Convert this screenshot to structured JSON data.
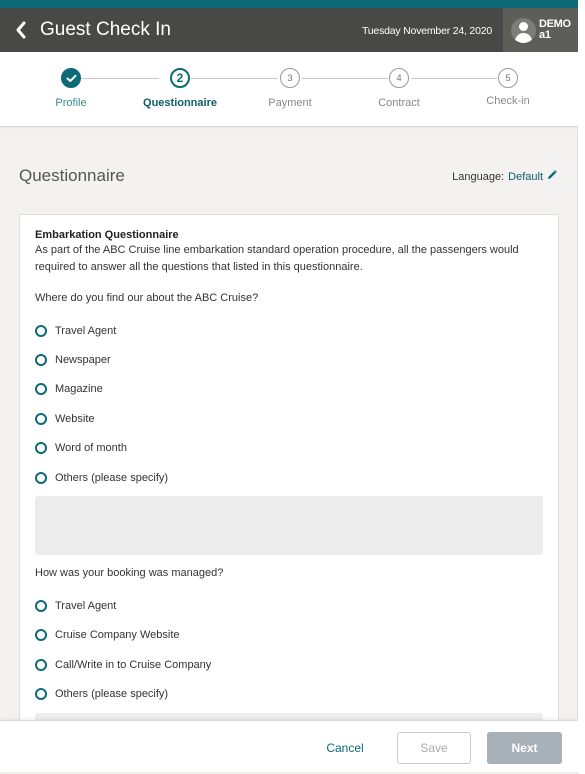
{
  "header": {
    "title": "Guest Check In",
    "back_icon": "chevron-left-icon",
    "date": "Tuesday November 24, 2020",
    "user": {
      "line1": "DEMO",
      "line2": "a1",
      "icon": "user-avatar-icon"
    }
  },
  "stepper": {
    "steps": [
      {
        "number": "1",
        "label": "Profile",
        "state": "done"
      },
      {
        "number": "2",
        "label": "Questionnaire",
        "state": "active"
      },
      {
        "number": "3",
        "label": "Payment",
        "state": "pending"
      },
      {
        "number": "4",
        "label": "Contract",
        "state": "pending"
      },
      {
        "number": "5",
        "label": "Check-in",
        "state": "pending"
      }
    ]
  },
  "section": {
    "title": "Questionnaire",
    "language_label": "Language:",
    "language_value": "Default",
    "edit_icon": "pencil-icon"
  },
  "questionnaire": {
    "heading": "Embarkation Questionnaire",
    "description": "As part of the ABC Cruise line embarkation standard operation procedure, all the passengers would required to answer all the questions that listed in this questionnaire.",
    "questions": [
      {
        "text": "Where do you find our about the ABC Cruise?",
        "options": [
          "Travel Agent",
          "Newspaper",
          "Magazine",
          "Website",
          "Word of month",
          "Others (please specify)"
        ],
        "other_value": ""
      },
      {
        "text": "How was your booking was managed?",
        "options": [
          "Travel Agent",
          "Cruise Company Website",
          "Call/Write in to Cruise Company",
          "Others (please specify)"
        ],
        "other_value": ""
      }
    ]
  },
  "footer": {
    "cancel_label": "Cancel",
    "save_label": "Save",
    "next_label": "Next"
  },
  "colors": {
    "accent": "#0d6b78",
    "header_bg": "#484846",
    "next_disabled": "#a8b1b8"
  }
}
